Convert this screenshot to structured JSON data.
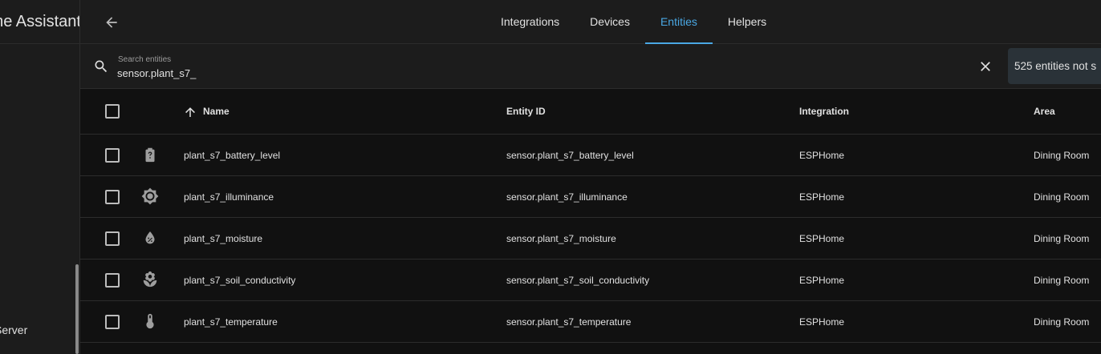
{
  "sidebar": {
    "app_title": "Home Assistant",
    "server_label": "Server"
  },
  "topbar": {
    "tabs": [
      {
        "label": "Integrations"
      },
      {
        "label": "Devices"
      },
      {
        "label": "Entities"
      },
      {
        "label": "Helpers"
      }
    ],
    "active_tab": "Entities"
  },
  "search": {
    "label": "Search entities",
    "value": "sensor.plant_s7_",
    "hidden_badge": "525 entities not s"
  },
  "table": {
    "headers": {
      "name": "Name",
      "entity_id": "Entity ID",
      "integration": "Integration",
      "area": "Area"
    },
    "rows": [
      {
        "icon": "battery-unknown-icon",
        "name": "plant_s7_battery_level",
        "entity_id": "sensor.plant_s7_battery_level",
        "integration": "ESPHome",
        "area": "Dining Room"
      },
      {
        "icon": "brightness-icon",
        "name": "plant_s7_illuminance",
        "entity_id": "sensor.plant_s7_illuminance",
        "integration": "ESPHome",
        "area": "Dining Room"
      },
      {
        "icon": "water-percent-icon",
        "name": "plant_s7_moisture",
        "entity_id": "sensor.plant_s7_moisture",
        "integration": "ESPHome",
        "area": "Dining Room"
      },
      {
        "icon": "flower-icon",
        "name": "plant_s7_soil_conductivity",
        "entity_id": "sensor.plant_s7_soil_conductivity",
        "integration": "ESPHome",
        "area": "Dining Room"
      },
      {
        "icon": "thermometer-icon",
        "name": "plant_s7_temperature",
        "entity_id": "sensor.plant_s7_temperature",
        "integration": "ESPHome",
        "area": "Dining Room"
      }
    ]
  },
  "colors": {
    "accent": "#4aa8e4",
    "background": "#111111",
    "surface": "#1c1c1c",
    "text": "#e1e1e1",
    "icon": "#9e9e9e"
  }
}
